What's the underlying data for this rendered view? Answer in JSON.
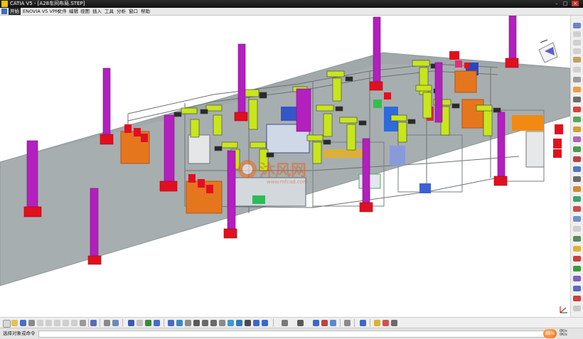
{
  "window": {
    "title": "CATIA V5 - [A28车间布局.STEP]"
  },
  "menu": {
    "start": "开始",
    "items": [
      "ENOVIA V5 VPM",
      "文件",
      "编辑",
      "视图",
      "插入",
      "工具",
      "分析",
      "窗口",
      "帮助"
    ]
  },
  "viewport": {
    "floor_color": "#a7aeb0",
    "pillar_color": "#b41fbf",
    "base_color": "#e0101f",
    "robot_color": "#c8e61c",
    "watermark_text": "沐风网",
    "watermark_url": "www.mfcad.com",
    "compass_icon": "compass-icon"
  },
  "status": {
    "prompt": "选择对象或命令",
    "zoom": "89%",
    "speed_up": "0K/s",
    "speed_down": "0K/s"
  },
  "colors": {
    "titlebar": "#1a1a1a",
    "accent": "#f0761a"
  }
}
